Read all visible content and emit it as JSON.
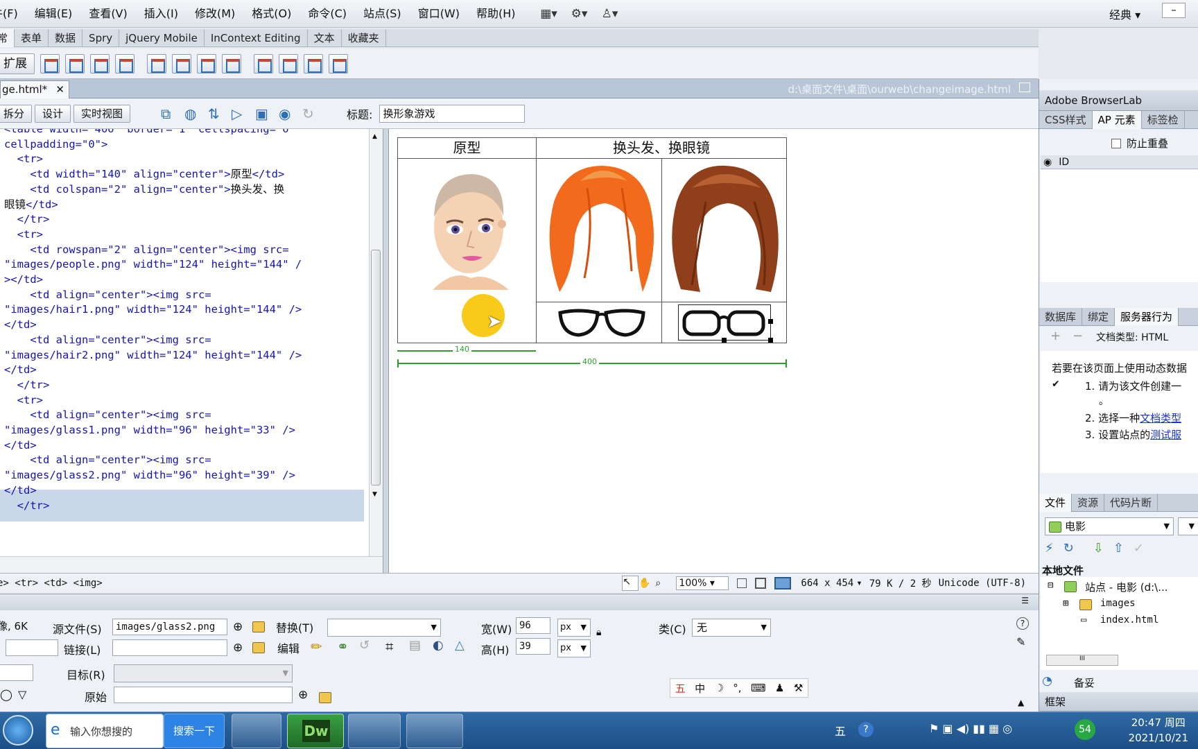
{
  "menu": {
    "items": [
      "牛(F)",
      "编辑(E)",
      "查看(V)",
      "插入(I)",
      "修改(M)",
      "格式(O)",
      "命令(C)",
      "站点(S)",
      "窗口(W)",
      "帮助(H)"
    ],
    "workspace": "经典"
  },
  "insert_tabs": [
    "常",
    "表单",
    "数据",
    "Spry",
    "jQuery Mobile",
    "InContext Editing",
    "文本",
    "收藏夹"
  ],
  "extend_label": "扩展",
  "doc": {
    "tab_name": "ge.html*",
    "path": "d:\\桌面文件\\桌面\\ourweb\\changeimage.html",
    "views": [
      "拆分",
      "设计",
      "实时视图"
    ],
    "title_label": "标题:",
    "title_value": "换形象游戏"
  },
  "code_lines": [
    [
      [
        "tag",
        "<table width=\"400\" border=\"1\" cellspacing=\"0\""
      ]
    ],
    [
      [
        "tag",
        "cellpadding=\"0\">"
      ]
    ],
    [
      [
        "tag",
        "  <tr>"
      ]
    ],
    [
      [
        "tag",
        "    <td width=\"140\" align=\"center\">"
      ],
      [
        "txt",
        "原型"
      ],
      [
        "tag",
        "</td>"
      ]
    ],
    [
      [
        "tag",
        "    <td colspan=\"2\" align=\"center\">"
      ],
      [
        "txt",
        "换头发、换"
      ]
    ],
    [
      [
        "txt",
        "眼镜"
      ],
      [
        "tag",
        "</td>"
      ]
    ],
    [
      [
        "tag",
        "  </tr>"
      ]
    ],
    [
      [
        "tag",
        "  <tr>"
      ]
    ],
    [
      [
        "tag",
        "    <td rowspan=\"2\" align=\"center\"><img src="
      ]
    ],
    [
      [
        "tag",
        "\"images/people.png\" width=\"124\" height=\"144\" /"
      ]
    ],
    [
      [
        "tag",
        "></td>"
      ]
    ],
    [
      [
        "tag",
        "    <td align=\"center\"><img src="
      ]
    ],
    [
      [
        "tag",
        "\"images/hair1.png\" width=\"124\" height=\"144\" />"
      ]
    ],
    [
      [
        "tag",
        "</td>"
      ]
    ],
    [
      [
        "tag",
        "    <td align=\"center\"><img src="
      ]
    ],
    [
      [
        "tag",
        "\"images/hair2.png\" width=\"124\" height=\"144\" />"
      ]
    ],
    [
      [
        "tag",
        "</td>"
      ]
    ],
    [
      [
        "tag",
        "  </tr>"
      ]
    ],
    [
      [
        "tag",
        "  <tr>"
      ]
    ],
    [
      [
        "tag",
        "    <td align=\"center\"><img src="
      ]
    ],
    [
      [
        "tag",
        "\"images/glass1.png\" width=\"96\" height=\"33\" />"
      ]
    ],
    [
      [
        "tag",
        "</td>"
      ]
    ],
    [
      [
        "tag",
        "    <td align=\"center\"><img src="
      ]
    ],
    [
      [
        "tag",
        "\"images/glass2.png\" width=\"96\" height=\"39\" />"
      ]
    ],
    [
      [
        "tag",
        "</td>"
      ]
    ],
    [
      [
        "tag",
        "  </tr>"
      ]
    ]
  ],
  "table_preview": {
    "header_left": "原型",
    "header_right": "换头发、换眼镜",
    "width_small": "140",
    "width_total": "400"
  },
  "status": {
    "tag_selector": "e> <tr> <td> <img>",
    "zoom": "100%",
    "dimensions": "664 x 454",
    "size_time": "79 K / 2 秒",
    "encoding": "Unicode (UTF-8)"
  },
  "properties": {
    "image_info": "像, 6K",
    "src_label": "源文件(S)",
    "src_value": "images/glass2.png",
    "alt_label": "替换(T)",
    "width_label": "宽(W)",
    "width_value": "96",
    "height_label": "高(H)",
    "height_value": "39",
    "unit": "px",
    "class_label": "类(C)",
    "class_value": "无",
    "link_label": "链接(L)",
    "edit_label": "编辑",
    "target_label": "目标(R)",
    "original_label": "原始"
  },
  "right_panel": {
    "browserlab": "Adobe BrowserLab",
    "css_tabs": [
      "CSS样式",
      "AP 元素",
      "标签检"
    ],
    "prevent_overlap": "防止重叠",
    "id_col": "ID",
    "db_tabs": [
      "数据库",
      "绑定",
      "服务器行为"
    ],
    "doc_type": "文档类型: HTML",
    "intro": "若要在该页面上使用动态数据",
    "steps": [
      "1. 请为该文件创建一",
      "2. 选择一种",
      "3. 设置站点的"
    ],
    "step_links": [
      "文档类型",
      "测试服"
    ],
    "files_tabs": [
      "文件",
      "资源",
      "代码片断"
    ],
    "site_select": "电影",
    "local_files": "本地文件",
    "tree": [
      "站点 - 电影 (d:\\...",
      "images",
      "index.html"
    ],
    "ready": "备妥",
    "frames": "框架"
  },
  "taskbar": {
    "search_placeholder": "输入你想搜的",
    "search_button": "搜索一下",
    "app_dw": "Dw",
    "time": "20:47 周四",
    "date": "2021/10/21",
    "badge": "54",
    "ime": "五"
  },
  "colors": {
    "code_tag": "#1414b4",
    "selection": "#c9d7e8",
    "link": "#1a33d6",
    "dimension_line": "#2ca02c"
  }
}
